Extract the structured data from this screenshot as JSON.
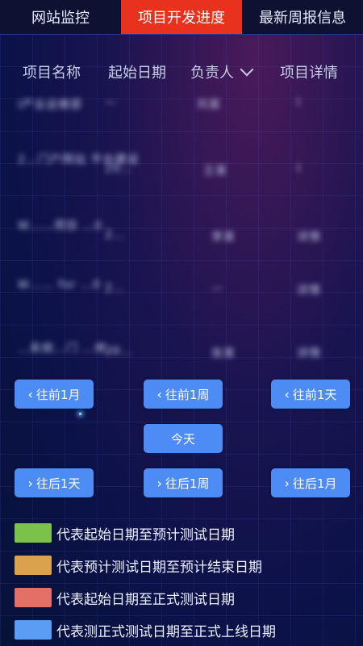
{
  "tabs": [
    {
      "label": "网站监控"
    },
    {
      "label": "项目开发进度"
    },
    {
      "label": "最新周报信息"
    }
  ],
  "table": {
    "headers": [
      "项目名称",
      "起始日期",
      "负责人",
      "项目详情"
    ],
    "rows": [
      [
        "Ⅰ产业运维部",
        "—",
        "刘某",
        "Ⅰ"
      ],
      [
        "2…门户网站 平台建设",
        "20…",
        "王某",
        "Ⅰ"
      ],
      [
        "W……项目 …0",
        "2…",
        "李某",
        "详情"
      ],
      [
        "W…… for …0",
        "2…",
        "—",
        "详情"
      ],
      [
        "…系统…门 …修…",
        "20…",
        "张某",
        "详情"
      ]
    ]
  },
  "nav_buttons": {
    "back_month": "往前1月",
    "back_week": "往前1周",
    "back_day": "往前1天",
    "today": "今天",
    "forward_day": "往后1天",
    "forward_week": "往后1周",
    "forward_month": "往后1月"
  },
  "legend": [
    {
      "color": "#7cc24a",
      "label": "代表起始日期至预计测试日期"
    },
    {
      "color": "#dba24e",
      "label": "代表预计测试日期至预计结束日期"
    },
    {
      "color": "#e27066",
      "label": "代表起始日期至正式测试日期"
    },
    {
      "color": "#5b9cf5",
      "label": "代表测正式测试日期至正式上线日期"
    }
  ],
  "icons": {
    "back": "chevron-left-icon",
    "forward": "chevron-right-icon",
    "filter": "chevron-down-icon"
  }
}
